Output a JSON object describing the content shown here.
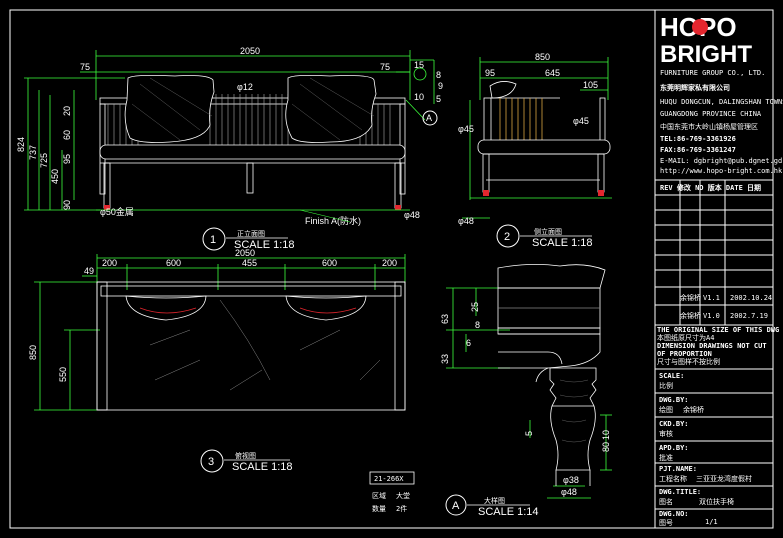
{
  "brand": {
    "logo_line1": "HOPO",
    "logo_line2": "BRIGHT",
    "group": "FURNITURE GROUP CO., LTD.",
    "company_cn": "东莞明辉家私有限公司",
    "address_en1": "HUQU DONGCUN, DALINGSHAN TOWNSHIP DONGGUAN",
    "address_en2": "GUANGDONG PROVINCE CHINA",
    "address_cn": "中国东莞市大岭山镇杨屋管理区",
    "tel": "TEL:86-769-3361926",
    "fax": "FAX:86-769-3361247",
    "email": "E-MAIL: dgbright@pub.dgnet.gd.cn",
    "web": "http://www.hopo-bright.com.hk"
  },
  "revisions": {
    "header": "REV 修改   NO 版本   DATE 日期",
    "rows": [
      {
        "name": "余锦桥",
        "ver": "V1.1",
        "date": "2002.10.24"
      },
      {
        "name": "余锦桥",
        "ver": "V1.0",
        "date": "2002.7.19"
      }
    ]
  },
  "notes": [
    "THE ORIGINAL SIZE OF THIS DWG IS A4",
    "本图纸原尺寸为A4",
    "DIMENSION DRAWINGS NOT CUT",
    "OF PROPORTION",
    "尺寸与图样不按比例"
  ],
  "title_block": {
    "scale_label": "SCALE:",
    "scale_cn": "比例",
    "dwg_by_label": "DWG.BY:",
    "dwg_by_cn": "绘图",
    "dwg_by_value": "余锦桥",
    "chk_by_label": "CKD.BY:",
    "chk_by_cn": "审核",
    "apd_by_label": "APD.BY:",
    "apd_by_cn": "批准",
    "pj_name_label": "PJT.NAME:",
    "pj_name_cn": "工程名称",
    "pj_name_value": "三亚亚龙湾度假村",
    "dwg_title_label": "DWG.TITLE:",
    "dwg_title_cn": "图名",
    "dwg_title_value": "双位扶手椅",
    "dwg_no_label": "DWG.NO:",
    "dwg_no_cn": "图号",
    "dwg_no_value": "1/1"
  },
  "views": {
    "front": {
      "num": "1",
      "cn": "正立面图",
      "scale": "SCALE 1:18"
    },
    "side": {
      "num": "2",
      "cn": "侧立面图",
      "scale": "SCALE 1:18"
    },
    "plan": {
      "num": "3",
      "cn": "俯视图",
      "scale": "SCALE 1:18"
    },
    "detail": {
      "num": "A",
      "cn": "大样图",
      "scale": "SCALE 1:14"
    }
  },
  "front_dims": {
    "width": "2050",
    "left": "75",
    "right": "75",
    "d12": "φ12",
    "h824": "824",
    "h737": "737",
    "h725": "725",
    "h450": "450",
    "h60": "60",
    "h95": "95",
    "h20": "20",
    "h90": "90",
    "t15": "15",
    "t8": "8",
    "t9": "9",
    "t5": "5",
    "t10": "10",
    "leg": "φ48",
    "finish": "Finish A(防水)",
    "tag": "A",
    "foot": "φ50金属"
  },
  "side_dims": {
    "d850": "850",
    "d645": "645",
    "d95": "95",
    "d105": "105",
    "d45a": "φ45",
    "d45b": "φ45",
    "d48": "φ48"
  },
  "plan_dims": {
    "width": "2050",
    "d49": "49",
    "d200a": "200",
    "d600a": "600",
    "d455": "455",
    "d600b": "600",
    "d200b": "200",
    "d850": "850",
    "d550": "550"
  },
  "detail_dims": {
    "d25": "25",
    "d8": "8",
    "d6": "6",
    "d63": "63",
    "d33": "33",
    "d5": "5",
    "d10": "10",
    "d80": "80",
    "d38": "φ38",
    "d48": "φ48"
  },
  "item": {
    "code": "21-266X",
    "area_label": "区域",
    "area_value": "大堂",
    "qty_label": "数量",
    "qty_value": "2件"
  }
}
